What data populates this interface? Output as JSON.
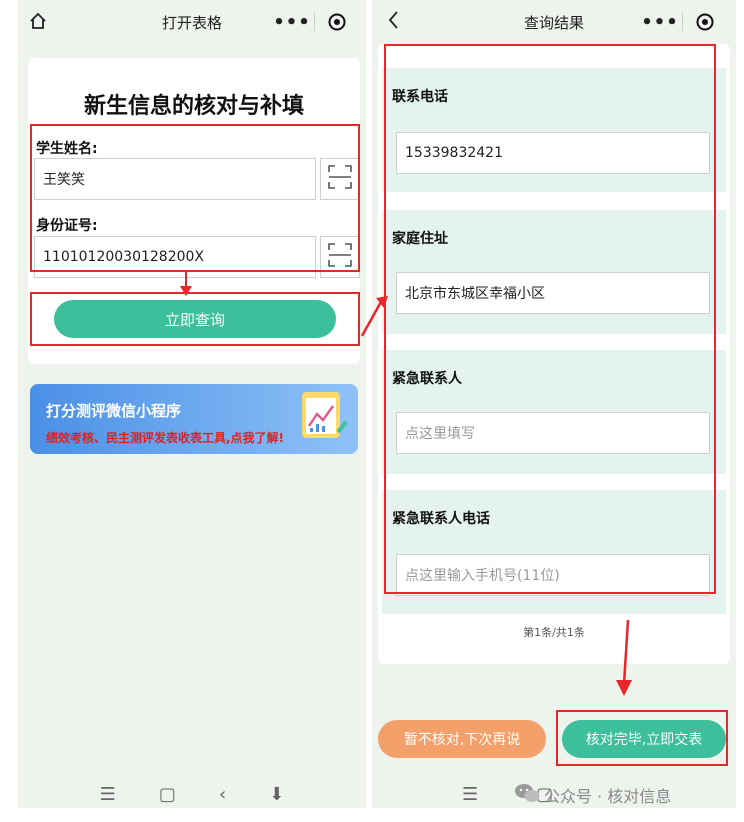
{
  "left": {
    "title": "打开表格",
    "card_heading": "新生信息的核对与补填",
    "name_label": "学生姓名:",
    "name_value": "王笑笑",
    "id_label": "身份证号:",
    "id_value": "11010120030128200X",
    "query_button": "立即查询",
    "banner_title": "打分测评微信小程序",
    "banner_subtitle": "绩效考核、民主测评发表收表工具,点我了解!",
    "nav": [
      "☰",
      "▢",
      "‹",
      "⬇"
    ]
  },
  "right": {
    "title": "查询结果",
    "fields": [
      {
        "label": "联系电话",
        "value": "15339832421",
        "placeholder": ""
      },
      {
        "label": "家庭住址",
        "value": "北京市东城区幸福小区",
        "placeholder": ""
      },
      {
        "label": "紧急联系人",
        "value": "",
        "placeholder": "点这里填写"
      },
      {
        "label": "紧急联系人电话",
        "value": "",
        "placeholder": "点这里输入手机号(11位)"
      }
    ],
    "pagination": "第1条/共1条",
    "later_button": "暂不核对,下次再说",
    "submit_button": "核对完毕,立即交表",
    "nav": [
      "☰",
      "▢"
    ]
  },
  "watermark": "公众号 · 核对信息",
  "colors": {
    "accent": "#3cbf9a",
    "orange": "#f4a06a",
    "highlight": "#e8272a",
    "banner": "#4a8fe6"
  }
}
